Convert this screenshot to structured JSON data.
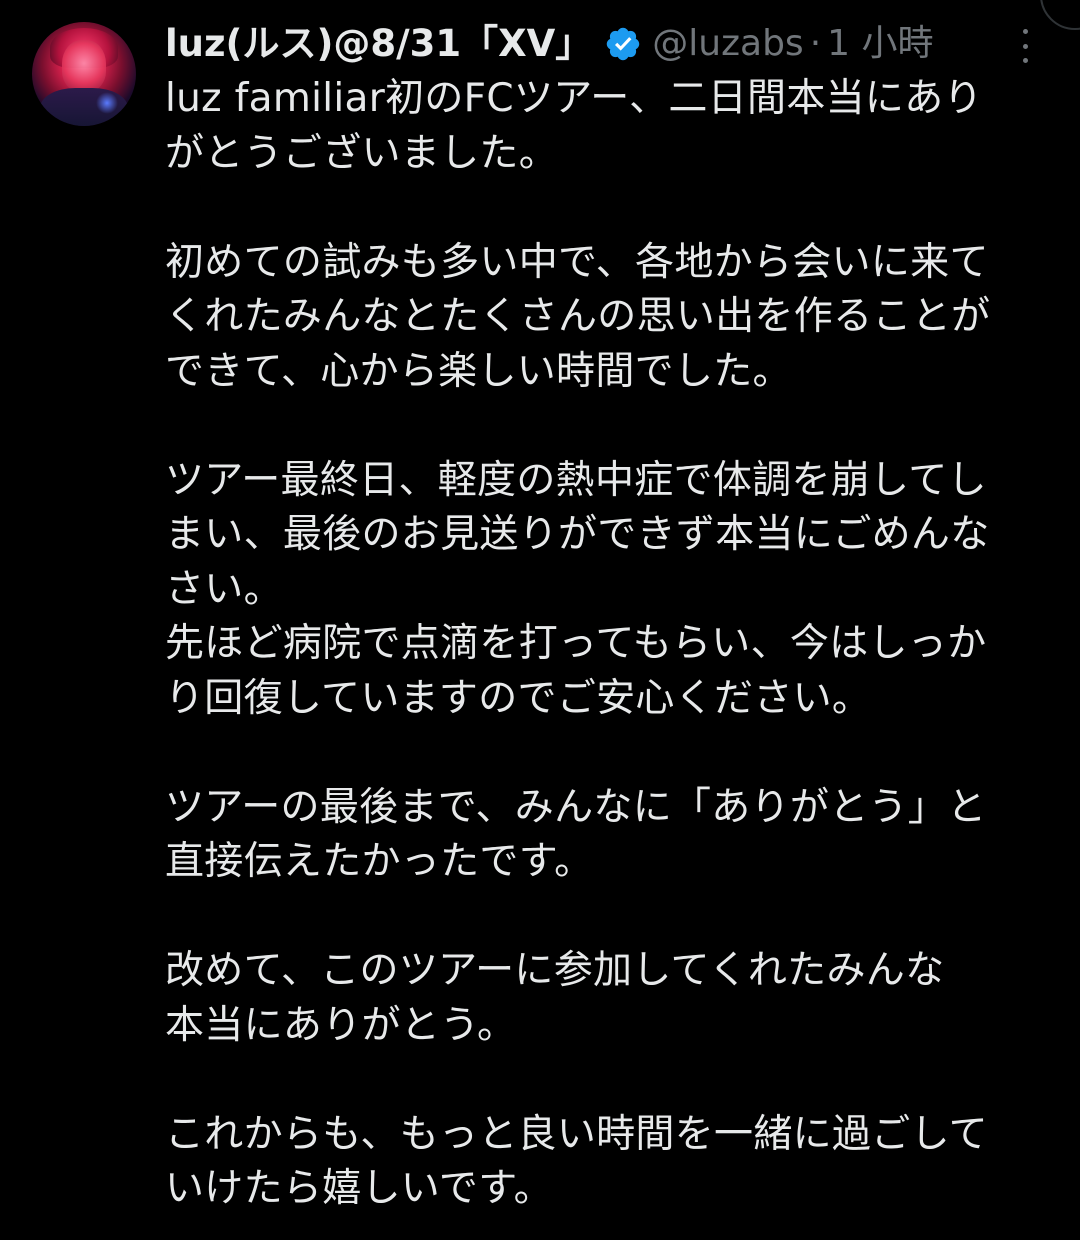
{
  "author": {
    "display_name": "luz(ルス)@8/31「XV」",
    "handle": "@luzabs",
    "separator": "·",
    "time": "1 小時",
    "verified": true,
    "verified_color": "#1d9bf0"
  },
  "tweet": {
    "lines": [
      "luz familiar初のFCツアー、二日間本当にあり",
      "がとうございました。",
      "",
      "初めての試みも多い中で、各地から会いに来て",
      "くれたみんなとたくさんの思い出を作ることが",
      "できて、心から楽しい時間でした。",
      "",
      "ツアー最終日、軽度の熱中症で体調を崩してし",
      "まい、最後のお見送りができず本当にごめんな",
      "さい。",
      "先ほど病院で点滴を打ってもらい、今はしっか",
      "り回復していますのでご安心ください。",
      "",
      "ツアーの最後まで、みんなに「ありがとう」と",
      "直接伝えたかったです。",
      "",
      "改めて、このツアーに参加してくれたみんな",
      "本当にありがとう。",
      "",
      "これからも、もっと良い時間を一緒に過ごして",
      "いけたら嬉しいです。"
    ]
  },
  "icons": {
    "more": "more-vertical-icon",
    "verified": "verified-badge-icon"
  },
  "colors": {
    "background": "#000000",
    "text": "#e7e9ea",
    "muted": "#71767b"
  }
}
